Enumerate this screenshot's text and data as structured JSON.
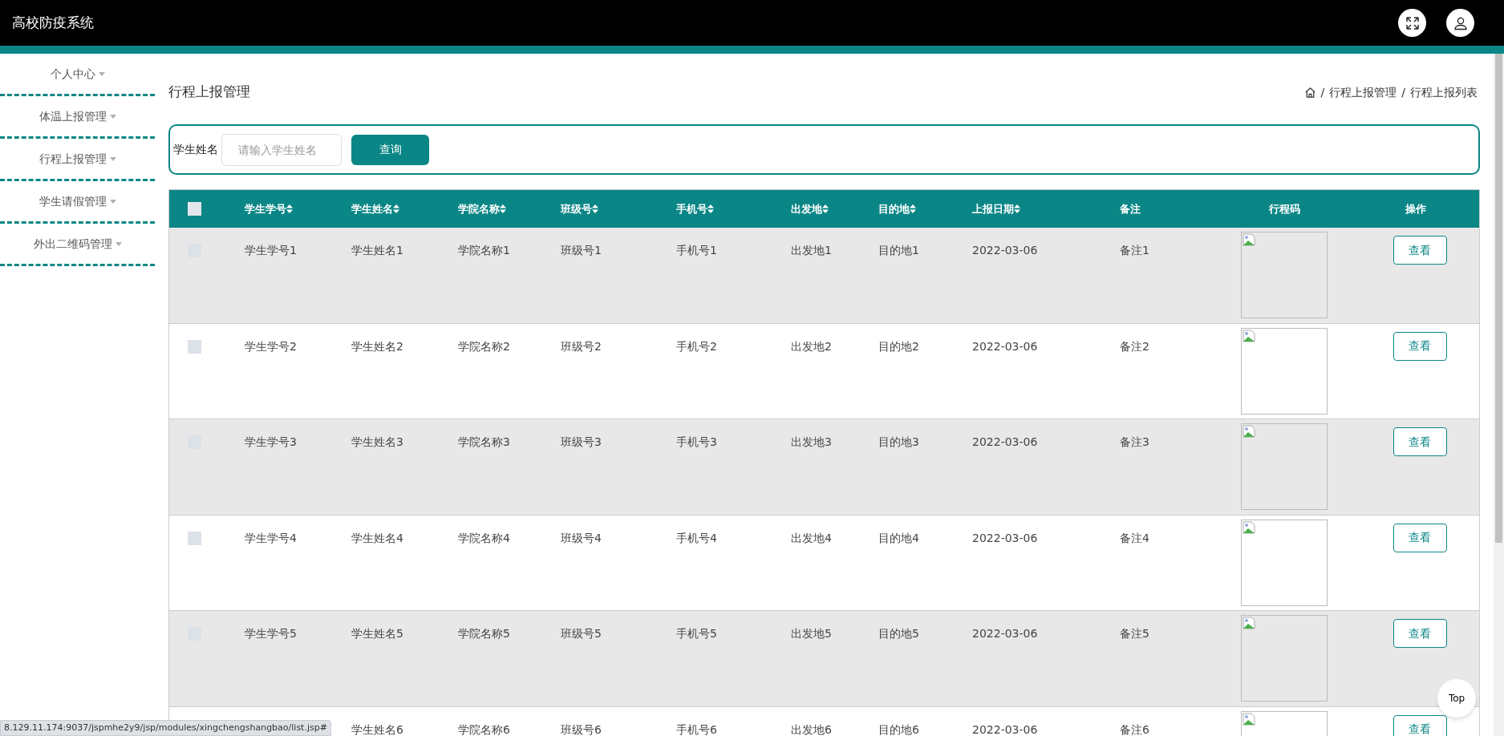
{
  "app_title": "高校防疫系统",
  "sidebar": {
    "items": [
      {
        "label": "个人中心"
      },
      {
        "label": "体温上报管理"
      },
      {
        "label": "行程上报管理"
      },
      {
        "label": "学生请假管理"
      },
      {
        "label": "外出二维码管理"
      }
    ]
  },
  "page_title": "行程上报管理",
  "breadcrumb": {
    "separator": "/",
    "items": [
      "行程上报管理",
      "行程上报列表"
    ]
  },
  "search": {
    "label": "学生姓名",
    "placeholder": "请输入学生姓名",
    "button": "查询"
  },
  "table": {
    "header_checked": false,
    "columns": [
      {
        "label": "学生学号",
        "sortable": true
      },
      {
        "label": "学生姓名",
        "sortable": true
      },
      {
        "label": "学院名称",
        "sortable": true
      },
      {
        "label": "班级号",
        "sortable": true
      },
      {
        "label": "手机号",
        "sortable": true
      },
      {
        "label": "出发地",
        "sortable": true
      },
      {
        "label": "目的地",
        "sortable": true
      },
      {
        "label": "上报日期",
        "sortable": true
      },
      {
        "label": "备注",
        "sortable": false
      },
      {
        "label": "行程码",
        "sortable": false
      },
      {
        "label": "操作",
        "sortable": false
      }
    ],
    "rows": [
      {
        "checked": false,
        "cells": [
          "学生学号1",
          "学生姓名1",
          "学院名称1",
          "班级号1",
          "手机号1",
          "出发地1",
          "目的地1",
          "2022-03-06",
          "备注1"
        ],
        "action": "查看"
      },
      {
        "checked": false,
        "cells": [
          "学生学号2",
          "学生姓名2",
          "学院名称2",
          "班级号2",
          "手机号2",
          "出发地2",
          "目的地2",
          "2022-03-06",
          "备注2"
        ],
        "action": "查看"
      },
      {
        "checked": false,
        "cells": [
          "学生学号3",
          "学生姓名3",
          "学院名称3",
          "班级号3",
          "手机号3",
          "出发地3",
          "目的地3",
          "2022-03-06",
          "备注3"
        ],
        "action": "查看"
      },
      {
        "checked": false,
        "cells": [
          "学生学号4",
          "学生姓名4",
          "学院名称4",
          "班级号4",
          "手机号4",
          "出发地4",
          "目的地4",
          "2022-03-06",
          "备注4"
        ],
        "action": "查看"
      },
      {
        "checked": false,
        "cells": [
          "学生学号5",
          "学生姓名5",
          "学院名称5",
          "班级号5",
          "手机号5",
          "出发地5",
          "目的地5",
          "2022-03-06",
          "备注5"
        ],
        "action": "查看"
      },
      {
        "cells": [
          null,
          "学生姓名6",
          "学院名称6",
          "班级号6",
          "手机号6",
          "出发地6",
          "目的地6",
          "2022-03-06",
          "备注6"
        ],
        "action": "查看"
      }
    ]
  },
  "top_button": "Top",
  "status_url": "8.129.11.174:9037/jspmhe2y9/jsp/modules/xingchengshangbao/list.jsp#"
}
